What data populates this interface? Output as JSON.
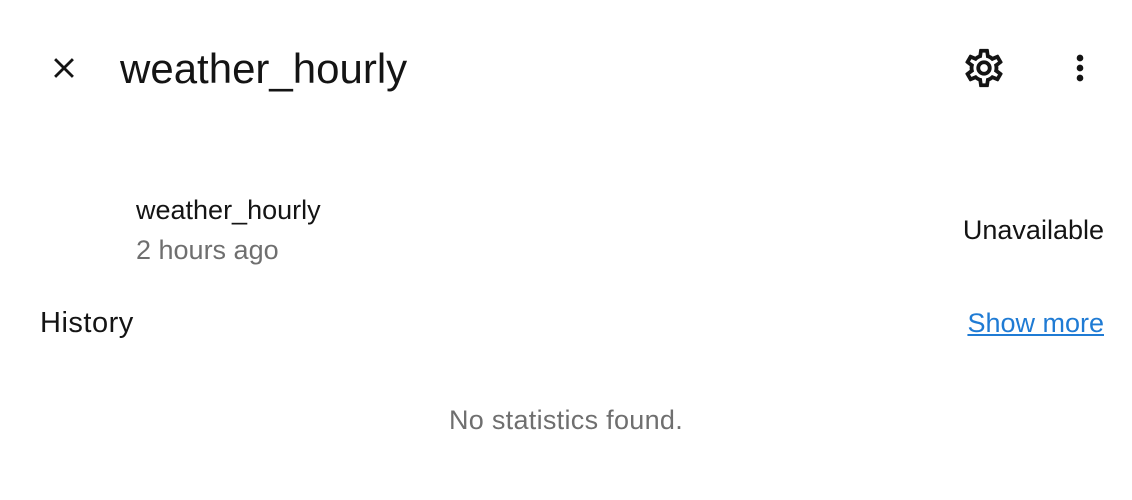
{
  "dialog": {
    "title": "weather_hourly",
    "icons": {
      "close": "close-icon",
      "settings": "gear-icon",
      "more": "more-vertical-icon"
    }
  },
  "entity": {
    "name": "weather_hourly",
    "last_changed": "2 hours ago",
    "state": "Unavailable"
  },
  "history": {
    "title": "History",
    "show_more_label": "Show more",
    "empty_message": "No statistics found."
  },
  "colors": {
    "text_primary": "#141414",
    "text_secondary": "#6f6f6f",
    "link": "#1f7bd4",
    "background": "#ffffff"
  }
}
